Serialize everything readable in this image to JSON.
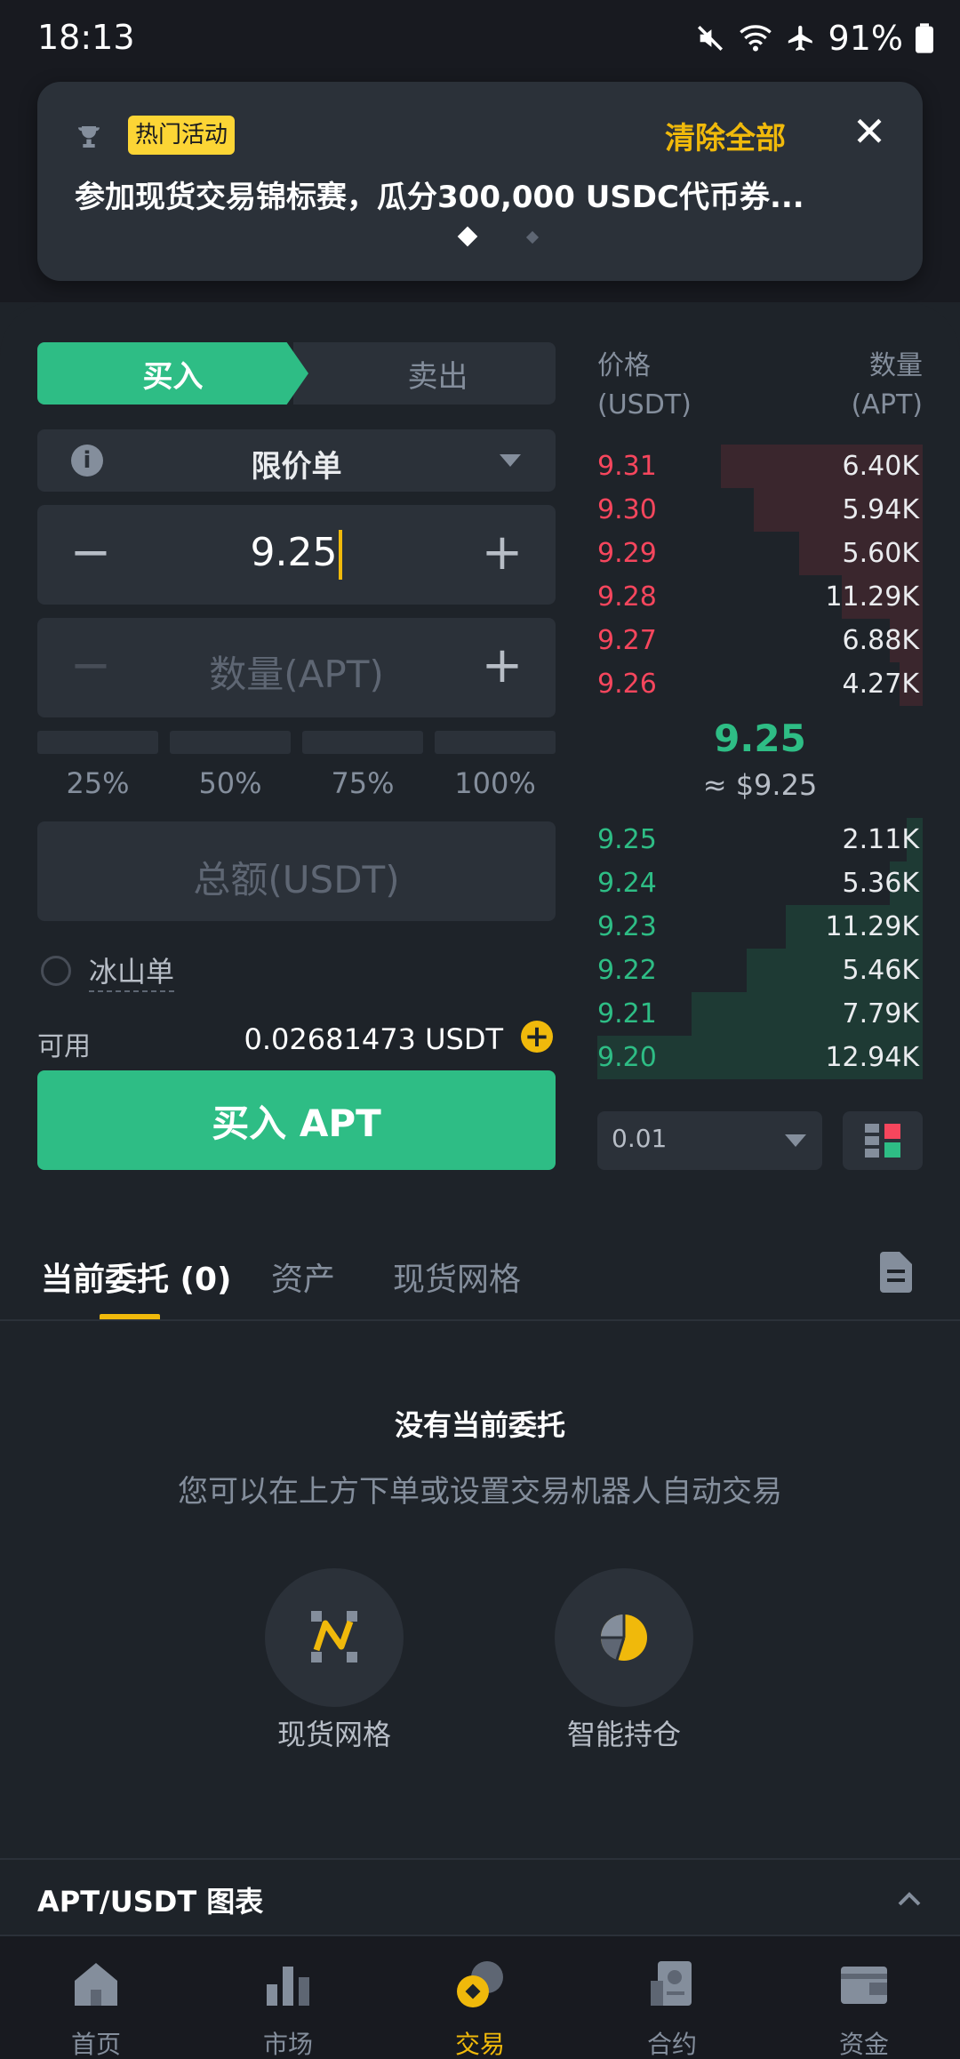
{
  "status_bar": {
    "time": "18:13",
    "battery": "91%"
  },
  "notification": {
    "badge": "热门活动",
    "clear_all": "清除全部",
    "close": "✕",
    "text": "参加现货交易锦标赛，瓜分300,000 USDC代币券..."
  },
  "trade_form": {
    "tabs": {
      "buy": "买入",
      "sell": "卖出"
    },
    "order_type": "限价单",
    "price_value": "9.25",
    "qty_placeholder": "数量(APT)",
    "percents": [
      "25%",
      "50%",
      "75%",
      "100%"
    ],
    "total_placeholder": "总额(USDT)",
    "iceberg": "冰山单",
    "available_label": "可用",
    "available_value": "0.02681473 USDT",
    "buy_button": "买入 APT"
  },
  "orderbook": {
    "header_price": [
      "价格",
      "(USDT)"
    ],
    "header_qty": [
      "数量",
      "(APT)"
    ],
    "asks": [
      {
        "price": "9.31",
        "qty": "6.40K",
        "depth": 0.62
      },
      {
        "price": "9.30",
        "qty": "5.94K",
        "depth": 0.52
      },
      {
        "price": "9.29",
        "qty": "5.60K",
        "depth": 0.38
      },
      {
        "price": "9.28",
        "qty": "11.29K",
        "depth": 0.25
      },
      {
        "price": "9.27",
        "qty": "6.88K",
        "depth": 0.1
      },
      {
        "price": "9.26",
        "qty": "4.27K",
        "depth": 0.07
      }
    ],
    "mid_price": "9.25",
    "mid_fiat": "≈ $9.25",
    "bids": [
      {
        "price": "9.25",
        "qty": "2.11K",
        "depth": 0.05
      },
      {
        "price": "9.24",
        "qty": "5.36K",
        "depth": 0.1
      },
      {
        "price": "9.23",
        "qty": "11.29K",
        "depth": 0.42
      },
      {
        "price": "9.22",
        "qty": "5.46K",
        "depth": 0.54
      },
      {
        "price": "9.21",
        "qty": "7.79K",
        "depth": 0.71
      },
      {
        "price": "9.20",
        "qty": "12.94K",
        "depth": 1.0
      }
    ],
    "precision": "0.01"
  },
  "bottom_tabs": {
    "open_orders": "当前委托 (0)",
    "assets": "资产",
    "spot_grid": "现货网格"
  },
  "empty_state": {
    "title": "没有当前委托",
    "subtitle": "您可以在上方下单或设置交易机器人自动交易",
    "features": [
      "现货网格",
      "智能持仓"
    ]
  },
  "chart_bar": {
    "title": "APT/USDT 图表"
  },
  "nav": [
    "首页",
    "市场",
    "交易",
    "合约",
    "资金"
  ],
  "colors": {
    "buy": "#2ebd85",
    "sell": "#f6465d",
    "accent": "#f0b90b"
  }
}
